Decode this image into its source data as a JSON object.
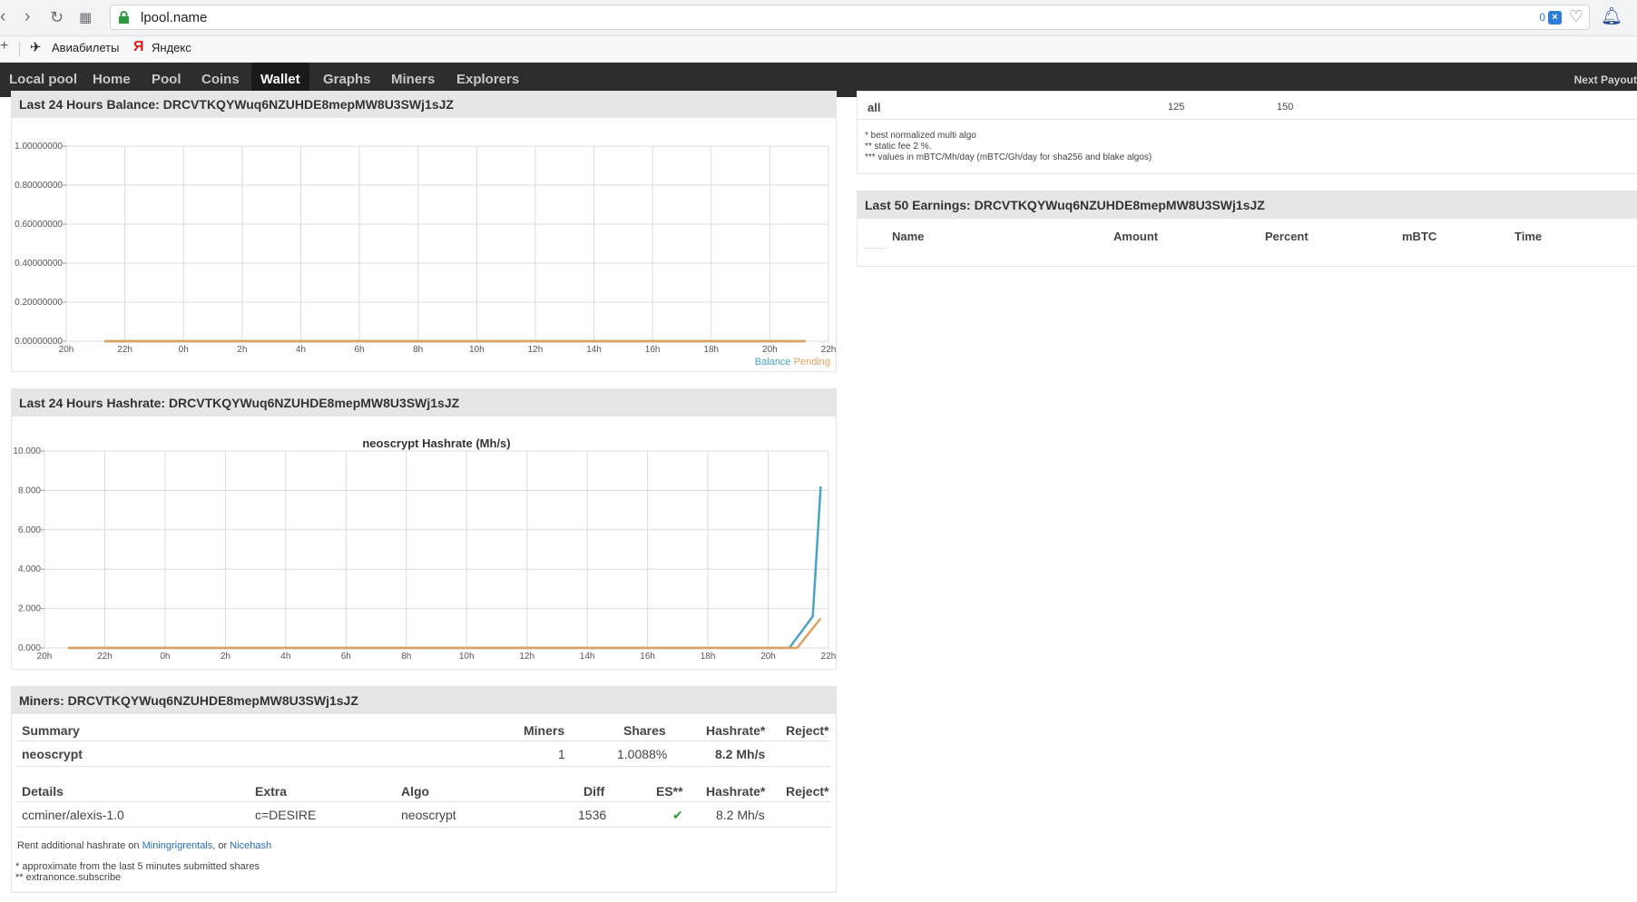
{
  "browser": {
    "url": "lpool.name",
    "badge_count": "0",
    "bookmarks": [
      {
        "label": "Авиабилеты"
      },
      {
        "label": "Яндекс"
      }
    ]
  },
  "nav": {
    "items": [
      "Local pool",
      "Home",
      "Pool",
      "Coins",
      "Wallet",
      "Graphs",
      "Miners",
      "Explorers"
    ],
    "active": "Wallet",
    "right_label": "Next Payout"
  },
  "balance_panel": {
    "title": "Last 24 Hours Balance: DRCVTKQYWuq6NZUHDE8mepMW8U3SWj1sJZ",
    "legend_balance": "Balance",
    "legend_pending": "Pending"
  },
  "hashrate_panel": {
    "title": "Last 24 Hours Hashrate: DRCVTKQYWuq6NZUHDE8mepMW8U3SWj1sJZ"
  },
  "chart_data": [
    {
      "type": "line",
      "title": "",
      "x": [
        "20h",
        "22h",
        "0h",
        "2h",
        "4h",
        "6h",
        "8h",
        "10h",
        "12h",
        "14h",
        "16h",
        "18h",
        "20h",
        "22h"
      ],
      "yticks": [
        "1.00000000",
        "0.80000000",
        "0.60000000",
        "0.40000000",
        "0.20000000",
        "0.00000000"
      ],
      "ylim": [
        0,
        1
      ],
      "series": [
        {
          "name": "Balance",
          "color": "#4aa3c4",
          "points": [
            [
              0.05,
              0
            ],
            [
              0.97,
              0
            ]
          ]
        },
        {
          "name": "Pending",
          "color": "#e0a060",
          "points": [
            [
              0.05,
              0
            ],
            [
              0.97,
              0
            ]
          ]
        }
      ],
      "grid": true,
      "legend": "bottom-right"
    },
    {
      "type": "line",
      "title": "neoscrypt Hashrate (Mh/s)",
      "x": [
        "20h",
        "22h",
        "0h",
        "2h",
        "4h",
        "6h",
        "8h",
        "10h",
        "12h",
        "14h",
        "16h",
        "18h",
        "20h",
        "22h"
      ],
      "yticks": [
        "10.000",
        "8.000",
        "6.000",
        "4.000",
        "2.000",
        "0.000"
      ],
      "ylim": [
        0,
        10
      ],
      "series": [
        {
          "color": "#4aa3c4",
          "points": [
            [
              0.03,
              0
            ],
            [
              0.95,
              0
            ],
            [
              0.98,
              1.6
            ],
            [
              0.99,
              8.2
            ]
          ]
        },
        {
          "color": "#e0a060",
          "points": [
            [
              0.03,
              0
            ],
            [
              0.96,
              0
            ],
            [
              0.99,
              1.5
            ]
          ]
        }
      ],
      "grid": true
    }
  ],
  "miners_panel": {
    "title": "Miners: DRCVTKQYWuq6NZUHDE8mepMW8U3SWj1sJZ",
    "summary_headers": [
      "Summary",
      "Miners",
      "Shares",
      "Hashrate*",
      "Reject*"
    ],
    "summary_row": {
      "algo": "neoscrypt",
      "miners": "1",
      "shares": "1.0088%",
      "hashrate": "8.2 Mh/s",
      "reject": ""
    },
    "detail_headers": [
      "Details",
      "Extra",
      "Algo",
      "Diff",
      "ES**",
      "Hashrate*",
      "Reject*"
    ],
    "detail_row": {
      "details": "ccminer/alexis-1.0",
      "extra": "c=DESIRE",
      "algo": "neoscrypt",
      "diff": "1536",
      "es": "✔",
      "hashrate": "8.2 Mh/s",
      "reject": ""
    },
    "rent_prefix": "Rent additional hashrate on",
    "rent_link1": "Miningrigrentals",
    "rent_mid": ", or",
    "rent_link2": "Nicehash",
    "note1": "* approximate from the last 5 minutes submitted shares",
    "note2": "** extranonce.subscribe"
  },
  "top_right": {
    "row_label": "all",
    "val1": "125",
    "val2": "150",
    "note1": "* best normalized multi algo",
    "note2": "** static fee 2 %.",
    "note3": "*** values in mBTC/Mh/day (mBTC/Gh/day for sha256 and blake algos)"
  },
  "earnings_panel": {
    "title": "Last 50 Earnings: DRCVTKQYWuq6NZUHDE8mepMW8U3SWj1sJZ",
    "headers": [
      "Name",
      "Amount",
      "Percent",
      "mBTC",
      "Time"
    ]
  }
}
